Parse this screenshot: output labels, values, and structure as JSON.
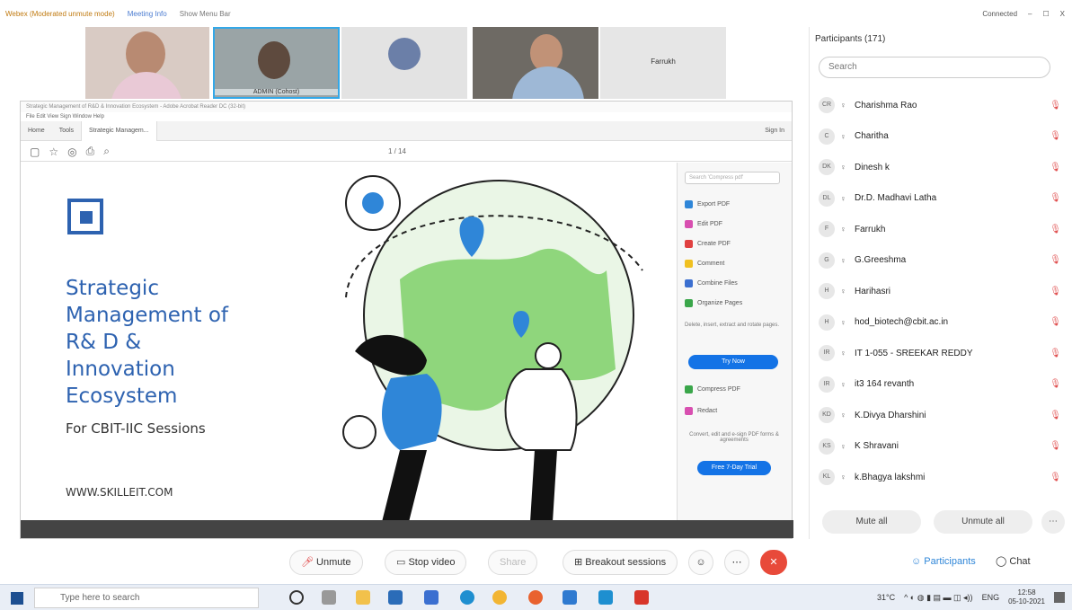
{
  "window": {
    "webex_label": "Webex (Moderated unmute mode)",
    "meeting_info": "Meeting Info",
    "menu_bar": "Show Menu Bar",
    "connection": "Connected",
    "minimize": "–",
    "maximize": "☐",
    "close": "X"
  },
  "videos": [
    {
      "name": ""
    },
    {
      "name": "ADMIN (Cohost)"
    },
    {
      "name": ""
    },
    {
      "name": ""
    },
    {
      "name": "Farrukh"
    }
  ],
  "acrobat": {
    "title": "Strategic Management of R&D & Innovation Ecosystem - Adobe Acrobat Reader DC (32-bit)",
    "menu": "File  Edit  View  Sign  Window  Help",
    "tabs": [
      "Home",
      "Tools",
      "Strategic Managem..."
    ],
    "sign_in": "Sign In",
    "page_count": "1 / 14"
  },
  "slide": {
    "title": "Strategic\nManagement of\n R& D &\nInnovation\nEcosystem",
    "subtitle": "For CBIT-IIC Sessions",
    "website": "WWW.SKILLEIT.COM"
  },
  "acro_panel": {
    "search": "Search 'Compress pdf'",
    "items": [
      "Export PDF",
      "Edit PDF",
      "Create PDF",
      "Comment",
      "Combine Files",
      "Organize Pages"
    ],
    "promo_text": "Delete, insert, extract and rotate pages.",
    "try_now": "Try Now",
    "items2": [
      "Compress PDF",
      "Redact"
    ],
    "promo2": "Convert, edit and e-sign PDF forms & agreements",
    "free_trial": "Free 7-Day Trial"
  },
  "participants": {
    "header": "Participants (171)",
    "search_placeholder": "Search",
    "list": [
      {
        "initials": "CR",
        "name": "Charishma Rao"
      },
      {
        "initials": "C",
        "name": "Charitha"
      },
      {
        "initials": "DK",
        "name": "Dinesh k"
      },
      {
        "initials": "DL",
        "name": "Dr.D. Madhavi Latha"
      },
      {
        "initials": "F",
        "name": "Farrukh"
      },
      {
        "initials": "G",
        "name": "G.Greeshma"
      },
      {
        "initials": "H",
        "name": "Harihasri"
      },
      {
        "initials": "H",
        "name": "hod_biotech@cbit.ac.in"
      },
      {
        "initials": "IR",
        "name": "IT 1-055 - SREEKAR REDDY"
      },
      {
        "initials": "IR",
        "name": "it3 164 revanth"
      },
      {
        "initials": "KD",
        "name": "K.Divya Dharshini"
      },
      {
        "initials": "KS",
        "name": "K Shravani"
      },
      {
        "initials": "KL",
        "name": "k.Bhagya lakshmi"
      }
    ],
    "mute_all": "Mute all",
    "unmute_all": "Unmute all"
  },
  "controls": {
    "unmute": "Unmute",
    "stop_video": "Stop video",
    "share": "Share",
    "breakout": "Breakout sessions",
    "participants_tab": "Participants",
    "chat_tab": "Chat"
  },
  "taskbar": {
    "search_placeholder": "Type here to search",
    "temperature": "31°C",
    "language": "ENG",
    "time": "12:58",
    "date": "05-10-2021"
  }
}
